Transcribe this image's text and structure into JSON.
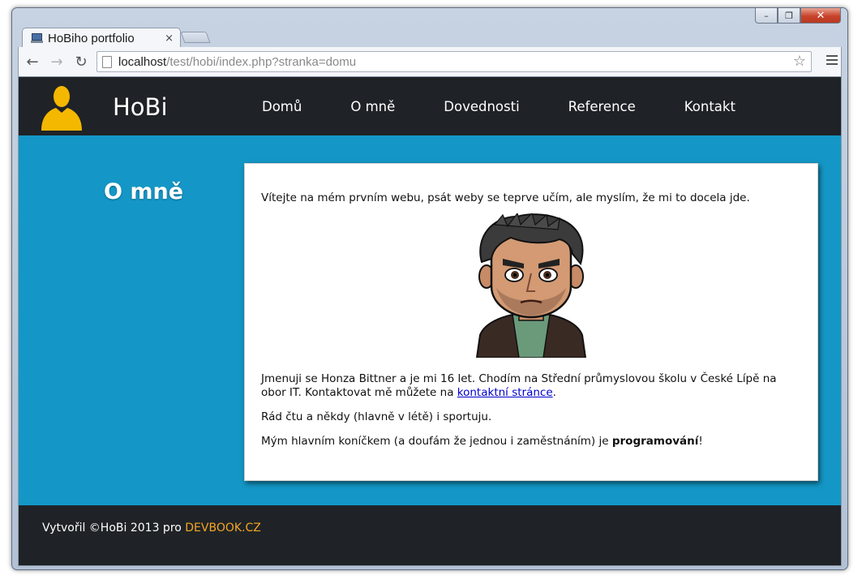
{
  "browser": {
    "tab_title": "HoBiho portfolio",
    "tab_close": "×",
    "url_host": "localhost",
    "url_path": "/test/hobi/index.php?stranka=domu",
    "win_min": "–",
    "win_max": "❐",
    "win_close": "✕",
    "back": "←",
    "forward": "→",
    "reload": "↻",
    "star": "☆"
  },
  "site": {
    "brand": "HoBi",
    "nav": [
      "Domů",
      "O mně",
      "Dovednosti",
      "Reference",
      "Kontakt"
    ],
    "heading": "O mně",
    "content": {
      "intro": "Vítejte na mém prvním webu, psát weby se teprve učím, ale myslím, že mi to docela jde.",
      "bio_text": "Jmenuji se Honza Bittner a je mi 16 let. Chodím na Střední průmyslovou školu v České Lípě na obor IT. Kontaktovat mě můžete na ",
      "bio_link": "kontaktní stránce",
      "bio_end": ".",
      "hobby": "Rád čtu a někdy (hlavně v létě) i sportuju.",
      "main_hobby_text": "Mým hlavním koníčkem (a doufám že jednou i zaměstnáním) je ",
      "main_hobby_strong": "programování",
      "main_hobby_end": "!"
    },
    "footer": {
      "text": "Vytvořil ©HoBi 2013 pro ",
      "link": "DEVBOOK.CZ"
    }
  },
  "colors": {
    "header_bg": "#1f2327",
    "page_bg": "#1497c6",
    "accent": "#f5a623",
    "link": "#0000cc"
  }
}
